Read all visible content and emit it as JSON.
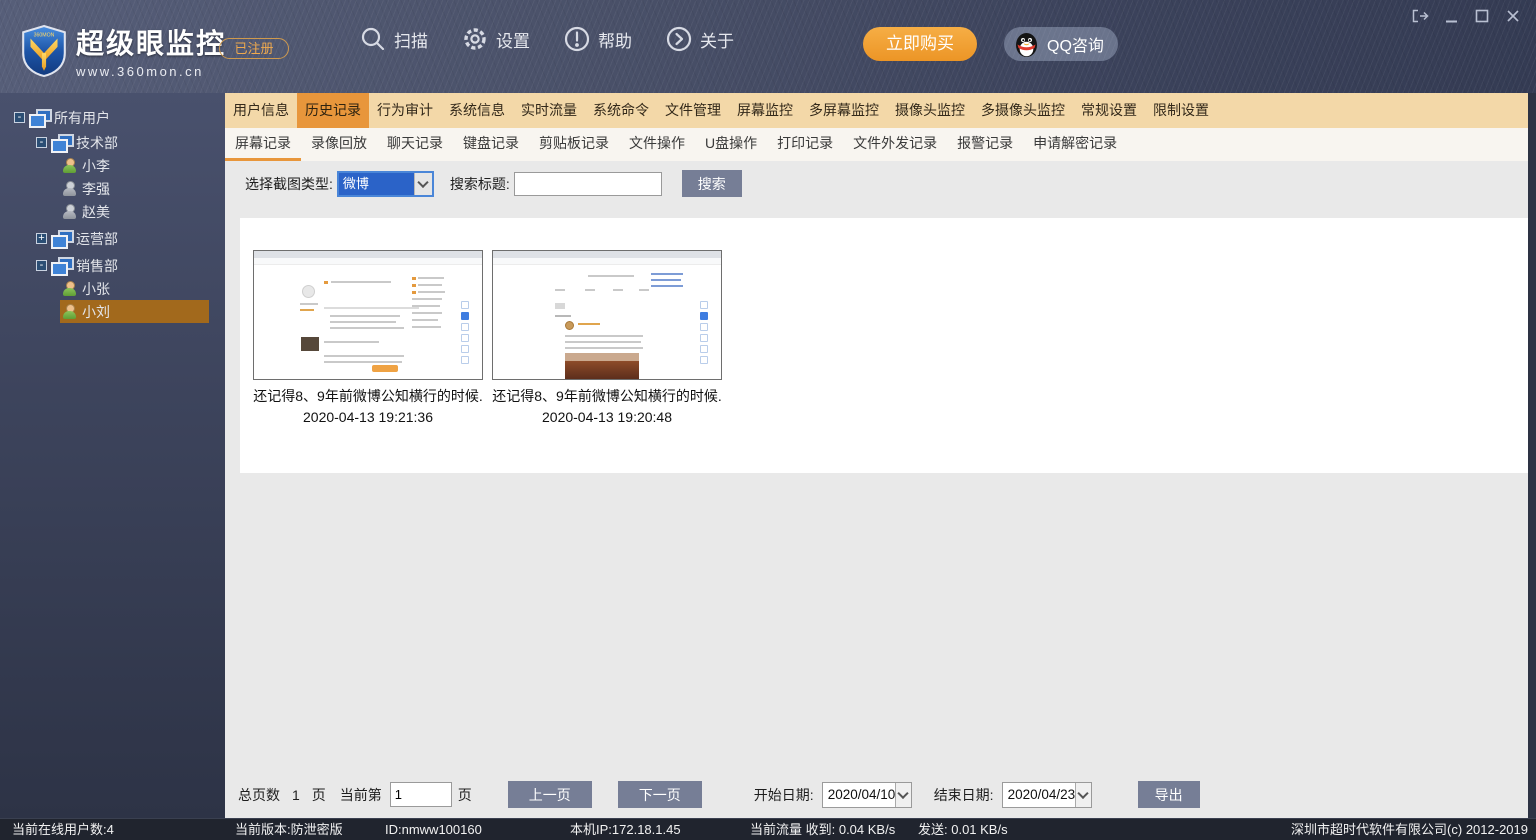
{
  "header": {
    "app_name": "超级眼监控",
    "website": "www.360mon.cn",
    "registered_badge": "已注册",
    "nav_items": [
      {
        "label": "扫描",
        "icon": "search-icon"
      },
      {
        "label": "设置",
        "icon": "gear-icon"
      },
      {
        "label": "帮助",
        "icon": "help-icon"
      },
      {
        "label": "关于",
        "icon": "about-icon"
      }
    ],
    "buy_button": "立即购买",
    "qq_button": "QQ咨询"
  },
  "sidebar": {
    "tree": [
      {
        "label": "所有用户",
        "kind": "group",
        "expander": "minus",
        "level": 0,
        "selected": false
      },
      {
        "label": "技术部",
        "kind": "group",
        "expander": "minus",
        "level": 1,
        "selected": false
      },
      {
        "label": "小李",
        "kind": "user-online",
        "level": 2,
        "selected": false
      },
      {
        "label": "李强",
        "kind": "user-offline",
        "level": 2,
        "selected": false
      },
      {
        "label": "赵美",
        "kind": "user-offline",
        "level": 2,
        "selected": false
      },
      {
        "label": "运营部",
        "kind": "group",
        "expander": "plus",
        "level": 1,
        "selected": false
      },
      {
        "label": "销售部",
        "kind": "group",
        "expander": "minus",
        "level": 1,
        "selected": false
      },
      {
        "label": "小张",
        "kind": "user-online",
        "level": 2,
        "selected": false
      },
      {
        "label": "小刘",
        "kind": "user-online",
        "level": 2,
        "selected": true
      }
    ]
  },
  "tabs": {
    "main": [
      "用户信息",
      "历史记录",
      "行为审计",
      "系统信息",
      "实时流量",
      "系统命令",
      "文件管理",
      "屏幕监控",
      "多屏幕监控",
      "摄像头监控",
      "多摄像头监控",
      "常规设置",
      "限制设置"
    ],
    "active_main": "历史记录",
    "sub": [
      "屏幕记录",
      "录像回放",
      "聊天记录",
      "键盘记录",
      "剪贴板记录",
      "文件操作",
      "U盘操作",
      "打印记录",
      "文件外发记录",
      "报警记录",
      "申请解密记录"
    ],
    "active_sub": "屏幕记录"
  },
  "filter": {
    "type_label": "选择截图类型:",
    "type_value": "微博",
    "title_label": "搜索标题:",
    "title_value": "",
    "search_button": "搜索"
  },
  "results": {
    "items": [
      {
        "title": "还记得8、9年前微博公知横行的时候.",
        "timestamp": "2020-04-13 19:21:36"
      },
      {
        "title": "还记得8、9年前微博公知横行的时候.",
        "timestamp": "2020-04-13 19:20:48"
      }
    ]
  },
  "pagination": {
    "total_label": "总页数",
    "total_value": "1",
    "unit": "页",
    "current_label": "当前第",
    "current_value": "1",
    "current_unit": "页",
    "prev_button": "上一页",
    "next_button": "下一页",
    "start_date_label": "开始日期:",
    "start_date_value": "2020/04/10",
    "end_date_label": "结束日期:",
    "end_date_value": "2020/04/23",
    "export_button": "导出"
  },
  "status_bar": {
    "online_users": "当前在线用户数:4",
    "version": "当前版本:防泄密版",
    "machine_id": "ID:nmww100160",
    "local_ip": "本机IP:172.18.1.45",
    "traffic_received": "当前流量 收到: 0.04 KB/s",
    "traffic_sent": "发送: 0.01 KB/s",
    "copyright": "深圳市超时代软件有限公司(c) 2012-2019"
  },
  "colors": {
    "accent_orange": "#e8963b",
    "tab_bar_bg": "#f3d8a8",
    "buy_orange": "#f0a032",
    "button_slate": "#767e96",
    "tree_selected_bg": "#a2691c",
    "select_highlight": "#2b63c8",
    "status_bar_bg": "#20242e"
  }
}
